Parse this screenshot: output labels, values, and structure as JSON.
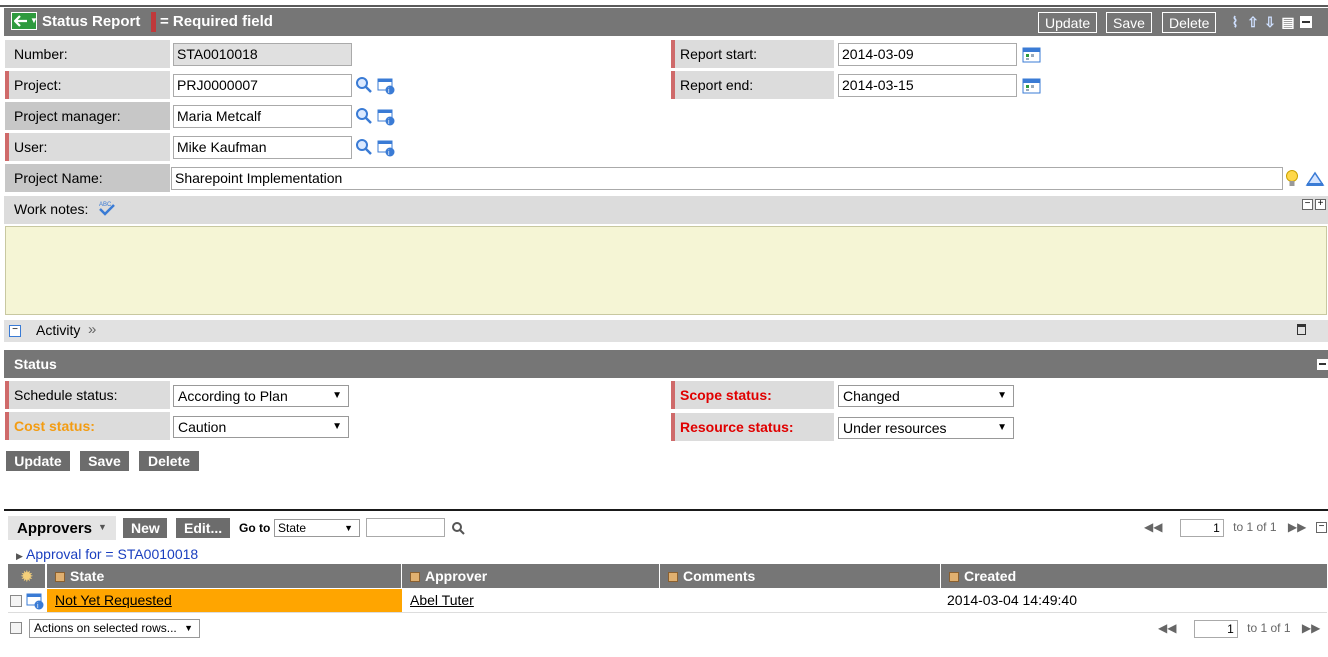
{
  "header": {
    "title": "Status Report",
    "required_legend": "= Required field",
    "buttons": {
      "update": "Update",
      "save": "Save",
      "delete": "Delete"
    }
  },
  "form": {
    "number": {
      "label": "Number:",
      "value": "STA0010018"
    },
    "project": {
      "label": "Project:",
      "value": "PRJ0000007"
    },
    "project_manager": {
      "label": "Project manager:",
      "value": "Maria Metcalf"
    },
    "user": {
      "label": "User:",
      "value": "Mike Kaufman"
    },
    "project_name": {
      "label": "Project Name:",
      "value": "Sharepoint Implementation"
    },
    "report_start": {
      "label": "Report start:",
      "value": "2014-03-09"
    },
    "report_end": {
      "label": "Report end:",
      "value": "2014-03-15"
    },
    "work_notes": {
      "label": "Work notes:",
      "value": ""
    }
  },
  "activity": {
    "label": "Activity",
    "chevron": "»"
  },
  "status_section": {
    "title": "Status",
    "schedule_status": {
      "label": "Schedule status:",
      "value": "According to Plan"
    },
    "cost_status": {
      "label": "Cost status:",
      "value": "Caution"
    },
    "scope_status": {
      "label": "Scope status:",
      "value": "Changed"
    },
    "resource_status": {
      "label": "Resource status:",
      "value": "Under resources"
    },
    "buttons": {
      "update": "Update",
      "save": "Save",
      "delete": "Delete"
    },
    "colors": {
      "cost_label": "#f39c12",
      "scope_label": "#e00000",
      "resource_label": "#e00000"
    }
  },
  "approvers": {
    "title": "Approvers",
    "new_label": "New",
    "edit_label": "Edit...",
    "goto_label": "Go to",
    "goto_field": "State",
    "search_value": "",
    "filter": "Approval for = STA0010018",
    "pager": {
      "page": "1",
      "text": "to 1 of 1"
    },
    "columns": [
      "State",
      "Approver",
      "Comments",
      "Created"
    ],
    "rows": [
      {
        "state": "Not Yet Requested",
        "approver": "Abel Tuter",
        "comments": "",
        "created": "2014-03-04 14:49:40",
        "state_color": "#ffa500"
      }
    ],
    "actions_label": "Actions on selected rows...",
    "footer_pager": {
      "page": "1",
      "text": "to 1 of 1"
    }
  }
}
